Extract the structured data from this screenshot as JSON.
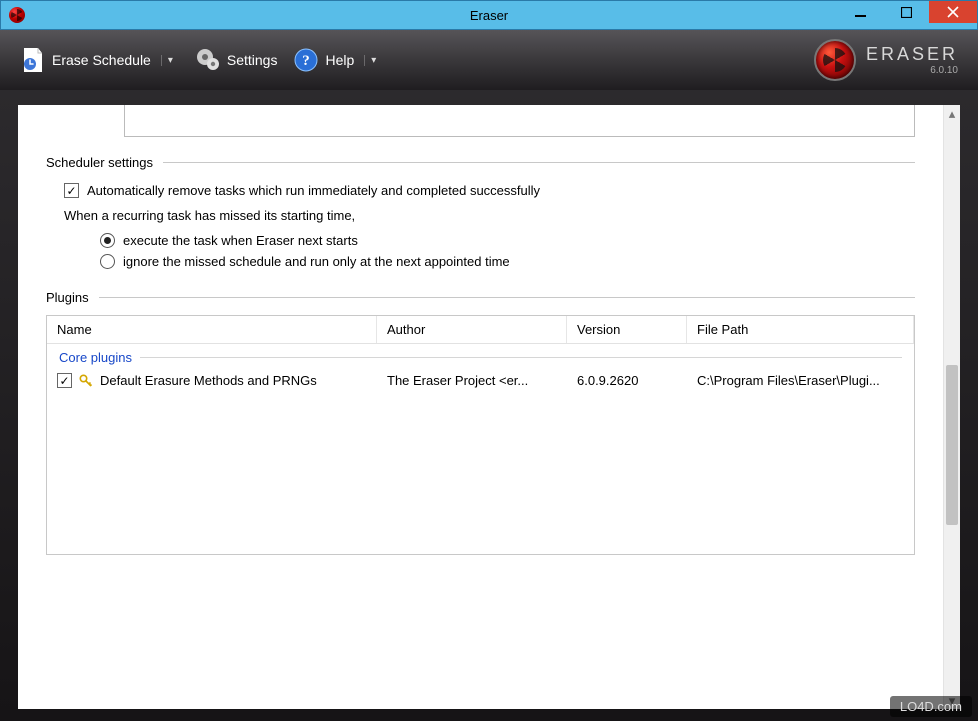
{
  "window": {
    "title": "Eraser"
  },
  "brand": {
    "name": "ERASER",
    "version": "6.0.10"
  },
  "toolbar": {
    "erase_schedule": "Erase Schedule",
    "settings": "Settings",
    "help": "Help"
  },
  "scheduler": {
    "heading": "Scheduler settings",
    "auto_remove": "Automatically remove tasks which run immediately and completed successfully",
    "missed_prompt": "When a recurring task has missed its starting time,",
    "opt_execute": "execute the task when Eraser next starts",
    "opt_ignore": "ignore the missed schedule and run only at the next appointed time"
  },
  "plugins": {
    "heading": "Plugins",
    "columns": {
      "name": "Name",
      "author": "Author",
      "version": "Version",
      "path": "File Path"
    },
    "category": "Core plugins",
    "rows": [
      {
        "name": "Default Erasure Methods and PRNGs",
        "author": "The Eraser Project <er...",
        "version": "6.0.9.2620",
        "path": "C:\\Program Files\\Eraser\\Plugi..."
      }
    ]
  },
  "watermark": "LO4D.com"
}
